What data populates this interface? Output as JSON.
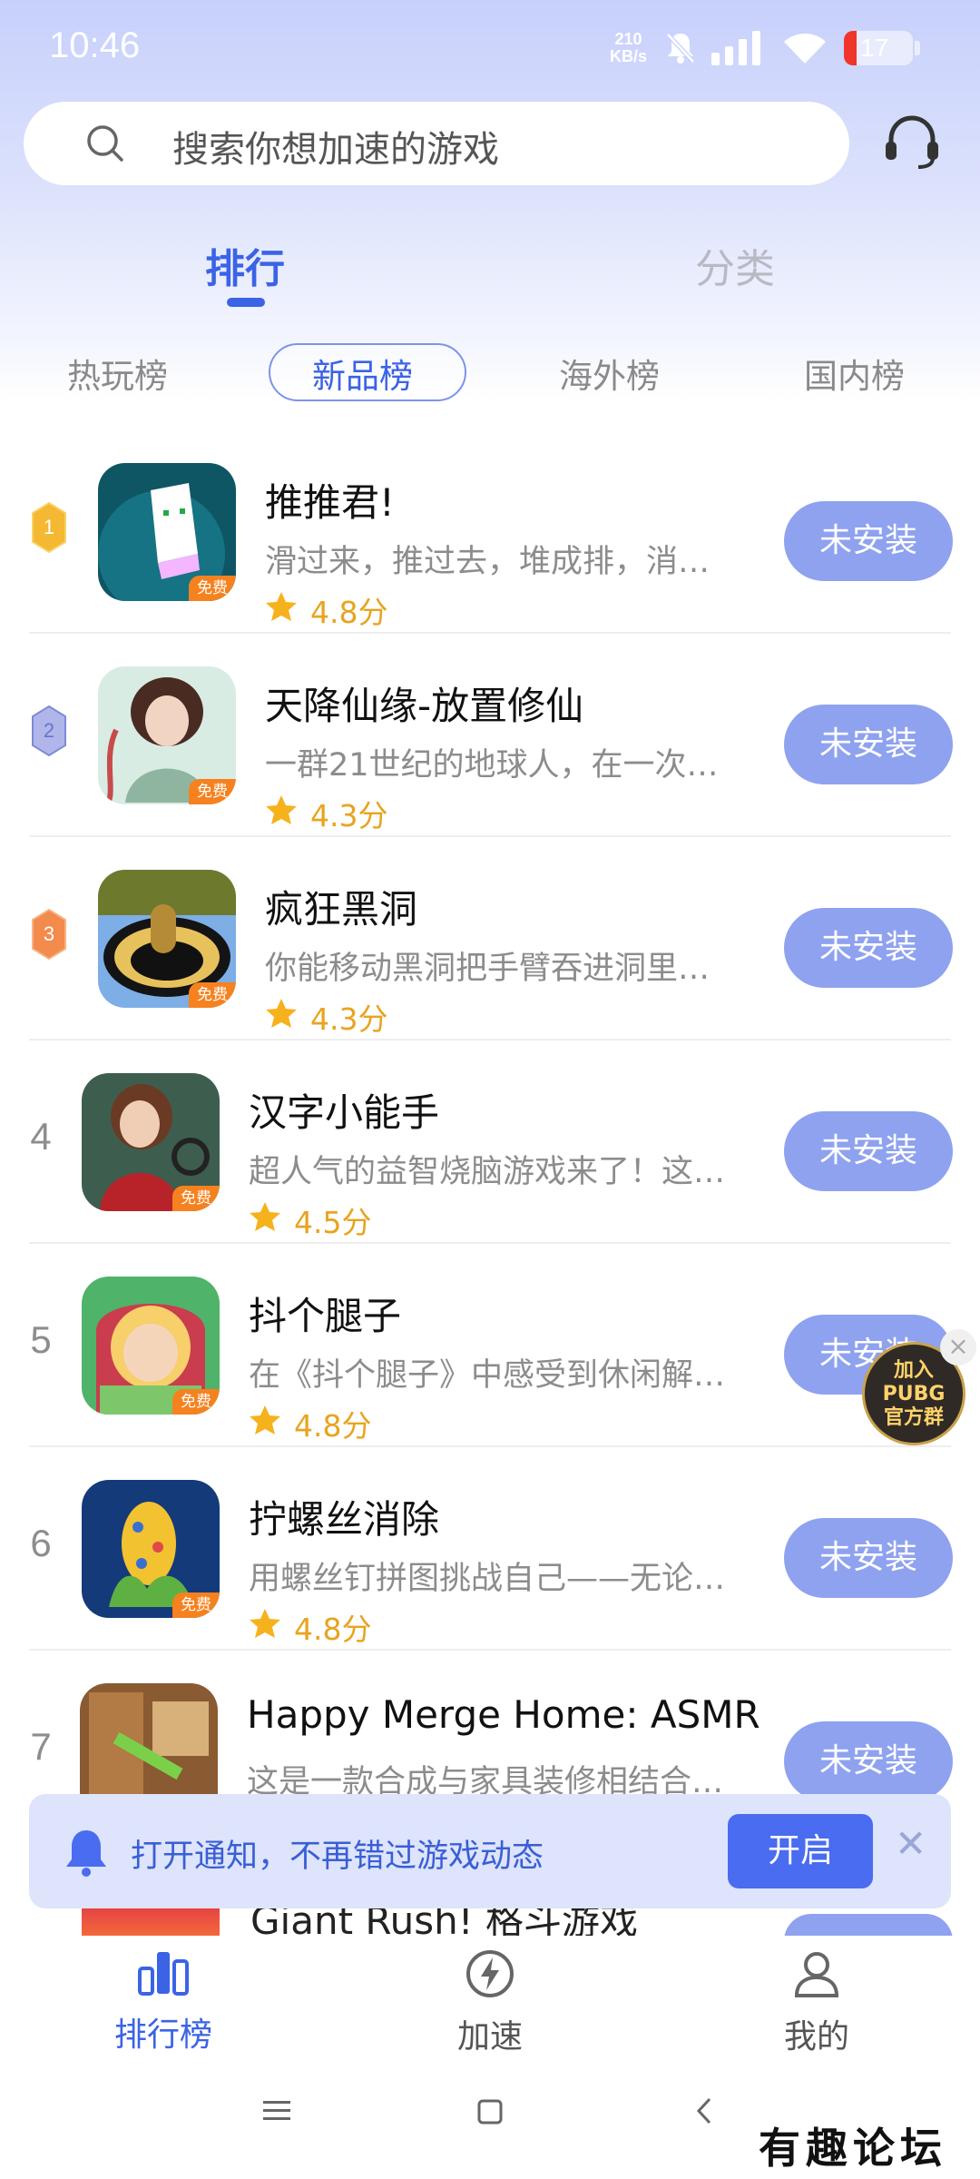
{
  "status_bar": {
    "time": "10:46",
    "net_speed_value": "210",
    "net_speed_unit": "KB/s",
    "battery": "17"
  },
  "search": {
    "placeholder": "搜索你想加速的游戏"
  },
  "main_tabs": [
    {
      "label": "排行",
      "active": true
    },
    {
      "label": "分类",
      "active": false
    }
  ],
  "sub_tabs": [
    {
      "label": "热玩榜",
      "active": false
    },
    {
      "label": "新品榜",
      "active": true
    },
    {
      "label": "海外榜",
      "active": false
    },
    {
      "label": "国内榜",
      "active": false
    }
  ],
  "free_label": "免费",
  "games": [
    {
      "rank": "1",
      "name": "推推君!",
      "desc": "滑过来，推过去，堆成排，消…",
      "rating": "4.8分",
      "action": "未安装"
    },
    {
      "rank": "2",
      "name": "天降仙缘-放置修仙",
      "desc": "一群21世纪的地球人，在一次…",
      "rating": "4.3分",
      "action": "未安装"
    },
    {
      "rank": "3",
      "name": "疯狂黑洞",
      "desc": "你能移动黑洞把手臂吞进洞里…",
      "rating": "4.3分",
      "action": "未安装"
    },
    {
      "rank": "4",
      "name": "汉字小能手",
      "desc": "超人气的益智烧脑游戏来了！这…",
      "rating": "4.5分",
      "action": "未安装"
    },
    {
      "rank": "5",
      "name": "抖个腿子",
      "desc": "在《抖个腿子》中感受到休闲解…",
      "rating": "4.8分",
      "action": "未安装"
    },
    {
      "rank": "6",
      "name": "拧螺丝消除",
      "desc": "用螺丝钉拼图挑战自己——无论…",
      "rating": "4.8分",
      "action": "未安装"
    },
    {
      "rank": "7",
      "name": "Happy Merge Home: ASMR",
      "desc": "这是一款合成与家具装修相结合…",
      "rating": "",
      "action": "未安装"
    }
  ],
  "peek_game": {
    "name": "Giant Rush! 格斗游戏"
  },
  "float_badge": {
    "line1": "加入",
    "line2": "PUBG",
    "line3": "官方群"
  },
  "notification": {
    "text": "打开通知，不再错过游戏动态",
    "button": "开启"
  },
  "bottom_nav": [
    {
      "label": "排行榜",
      "icon": "bar-chart-icon",
      "active": true
    },
    {
      "label": "加速",
      "icon": "lightning-icon",
      "active": false
    },
    {
      "label": "我的",
      "icon": "user-icon",
      "active": false
    }
  ],
  "watermark": "有趣论坛",
  "colors": {
    "accent": "#3b63e6",
    "install_button": "#8fa2ef",
    "rating": "#e8a420",
    "free_tag": "#f5821f"
  }
}
